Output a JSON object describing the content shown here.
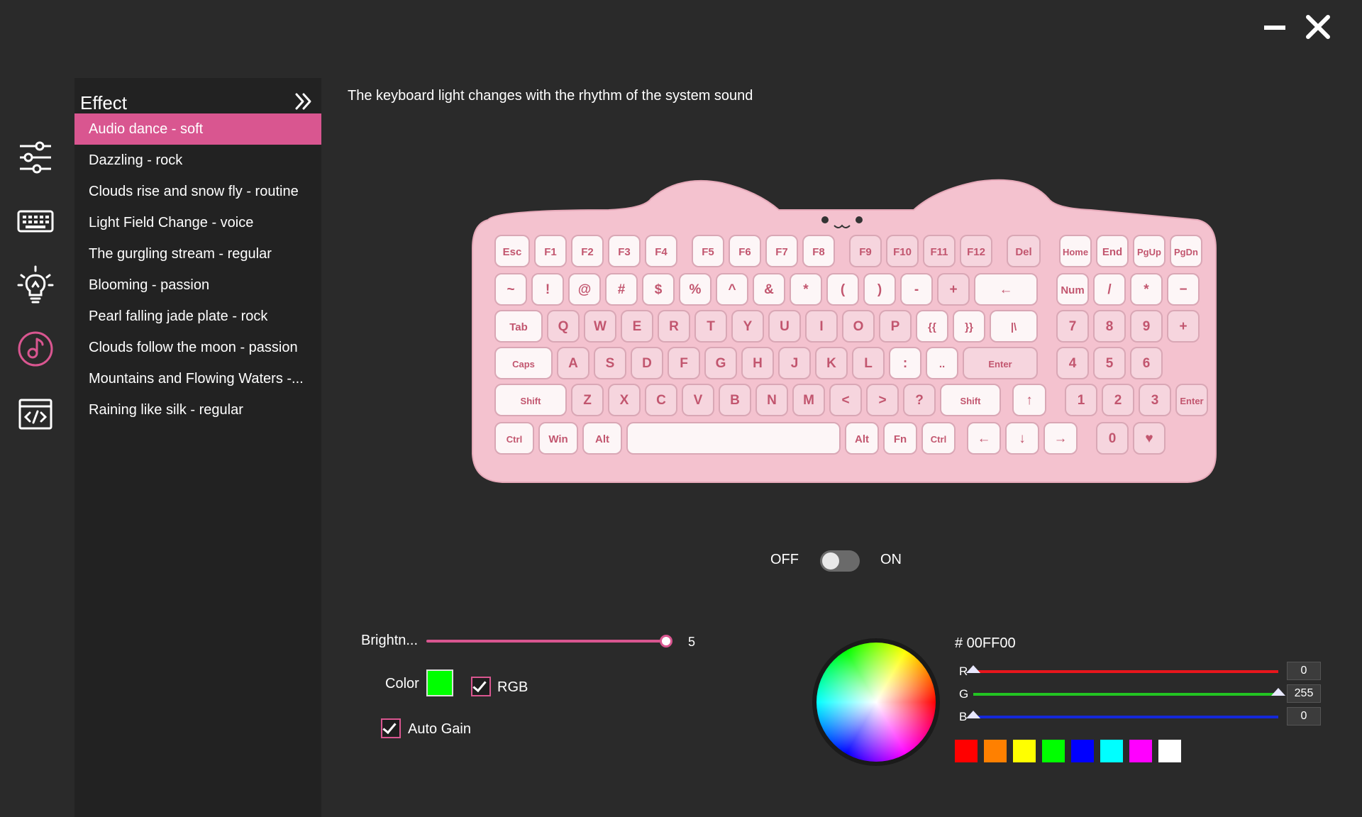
{
  "window": {
    "minimize_icon": "minimize-icon",
    "close_icon": "close-icon"
  },
  "nav": [
    {
      "icon": "sliders-icon"
    },
    {
      "icon": "keyboard-icon"
    },
    {
      "icon": "lightbulb-icon"
    },
    {
      "icon": "music-note-icon",
      "active": true,
      "color": "#d95690"
    },
    {
      "icon": "code-window-icon"
    }
  ],
  "effect_panel": {
    "title": "Effect",
    "collapse_icon": "double-chevron-right-icon",
    "items": [
      {
        "label": "Audio dance - soft",
        "active": true
      },
      {
        "label": "Dazzling - rock"
      },
      {
        "label": "Clouds rise and snow fly - routine"
      },
      {
        "label": "Light Field Change - voice"
      },
      {
        "label": "The gurgling stream - regular"
      },
      {
        "label": "Blooming - passion"
      },
      {
        "label": "Pearl falling jade plate - rock"
      },
      {
        "label": "Clouds follow the moon - passion"
      },
      {
        "label": "Mountains and Flowing Waters -..."
      },
      {
        "label": "Raining like silk - regular"
      }
    ]
  },
  "main": {
    "description": "The keyboard light changes with the rhythm of the system sound",
    "keyboard": {
      "rows": [
        [
          "Esc",
          "F1",
          "F2",
          "F3",
          "F4",
          "F5",
          "F6",
          "F7",
          "F8",
          "F9",
          "F10",
          "F11",
          "F12",
          "Del",
          "Home",
          "End",
          "PgUp",
          "PgDn"
        ],
        [
          "~",
          "!",
          "@",
          "#",
          "$",
          "%",
          "^",
          "&",
          "*",
          "(",
          ")",
          "-",
          "+",
          "←",
          "Num",
          "/",
          "*",
          "−"
        ],
        [
          "Tab",
          "Q",
          "W",
          "E",
          "R",
          "T",
          "Y",
          "U",
          "I",
          "O",
          "P",
          "{{",
          "}}",
          "|\\",
          "7",
          "8",
          "9",
          "+"
        ],
        [
          "Caps",
          "A",
          "S",
          "D",
          "F",
          "G",
          "H",
          "J",
          "K",
          "L",
          ":",
          "..",
          "Enter",
          "4",
          "5",
          "6"
        ],
        [
          "Shift",
          "Z",
          "X",
          "C",
          "V",
          "B",
          "N",
          "M",
          "<",
          ">",
          "?",
          "Shift",
          "↑",
          "1",
          "2",
          "3",
          "Enter"
        ],
        [
          "Ctrl",
          "Win",
          "Alt",
          "",
          "Alt",
          "Fn",
          "Ctrl",
          "←",
          "↓",
          "→",
          "0",
          "♥"
        ]
      ]
    },
    "toggle": {
      "off_label": "OFF",
      "on_label": "ON",
      "state": "off"
    },
    "brightness": {
      "label": "Brightn...",
      "value": "5",
      "fraction": 1.0
    },
    "color": {
      "label": "Color",
      "value": "#00ff00"
    },
    "rgb_checkbox": {
      "label": "RGB",
      "checked": true
    },
    "auto_gain": {
      "label": "Auto Gain",
      "checked": true
    },
    "picker": {
      "hex": "# 00FF00",
      "r": {
        "label": "R",
        "value": "0",
        "fraction": 0.0,
        "color": "#e8161c"
      },
      "g": {
        "label": "G",
        "value": "255",
        "fraction": 1.0,
        "color": "#22c422"
      },
      "b": {
        "label": "B",
        "value": "0",
        "fraction": 0.0,
        "color": "#1428d8"
      }
    },
    "presets": [
      "#ff0000",
      "#ff8000",
      "#ffff00",
      "#00ff00",
      "#0000ff",
      "#00ffff",
      "#ff00ff",
      "#ffffff"
    ]
  }
}
